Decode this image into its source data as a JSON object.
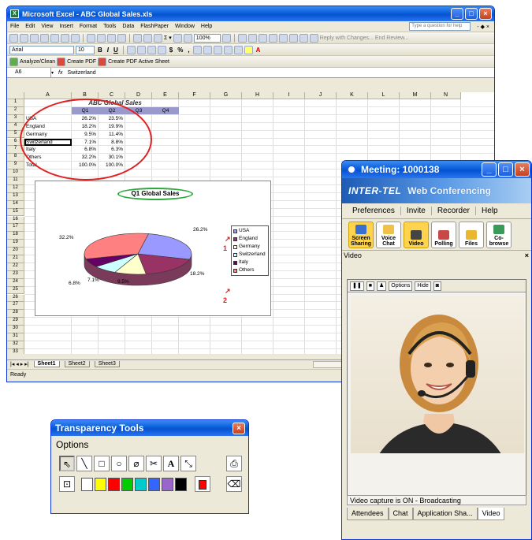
{
  "excel": {
    "title": "Microsoft Excel - ABC Global Sales.xls",
    "menu": [
      "File",
      "Edit",
      "View",
      "Insert",
      "Format",
      "Tools",
      "Data",
      "FlashPaper",
      "Window",
      "Help"
    ],
    "ask_placeholder": "Type a question for help",
    "mdi_controls": "- ◆ ×",
    "font_name": "Arial",
    "font_size": "10",
    "zoom": "100%",
    "toolbar3": [
      "Analyze/Clean",
      "Create PDF",
      "Create PDF Active Sheet"
    ],
    "reply_text": "Reply with Changes...",
    "end_review": "End Review...",
    "name_box": "A6",
    "formula_value": "Switzerland",
    "columns": [
      "A",
      "B",
      "C",
      "D",
      "E",
      "F",
      "G",
      "H",
      "I",
      "J",
      "K",
      "L",
      "M",
      "N"
    ],
    "rows": [
      "1",
      "2",
      "3",
      "4",
      "5",
      "6",
      "7",
      "8",
      "9",
      "10",
      "11",
      "12",
      "13",
      "14",
      "15",
      "16",
      "17",
      "18",
      "19",
      "20",
      "21",
      "22",
      "23",
      "24",
      "25",
      "26",
      "27",
      "28",
      "29",
      "30",
      "31",
      "32",
      "33"
    ],
    "sheet_title": "ABC Global Sales",
    "table": {
      "headers": [
        "Q1",
        "Q2",
        "Q3",
        "Q4"
      ],
      "rows": [
        {
          "country": "USA",
          "q1": "26.2%",
          "q2": "23.5%"
        },
        {
          "country": "England",
          "q1": "18.2%",
          "q2": "19.9%"
        },
        {
          "country": "Germany",
          "q1": "9.5%",
          "q2": "11.4%"
        },
        {
          "country": "Switzerland",
          "q1": "7.1%",
          "q2": "8.8%"
        },
        {
          "country": "Italy",
          "q1": "6.8%",
          "q2": "6.3%"
        },
        {
          "country": "Others",
          "q1": "32.2%",
          "q2": "30.1%"
        },
        {
          "country": "Total",
          "q1": "100.0%",
          "q2": "100.0%"
        }
      ]
    },
    "chart": {
      "title": "Q1 Global Sales",
      "labels": [
        "32.2%",
        "26.2%",
        "18.2%",
        "9.5%",
        "7.1%",
        "6.8%"
      ],
      "legend": [
        {
          "name": "USA",
          "color": "#9999ff"
        },
        {
          "name": "England",
          "color": "#993366"
        },
        {
          "name": "Germany",
          "color": "#ffffcc"
        },
        {
          "name": "Switzerland",
          "color": "#ccffff"
        },
        {
          "name": "Italy",
          "color": "#660066"
        },
        {
          "name": "Others",
          "color": "#ff8080"
        }
      ]
    },
    "annotations": [
      "1",
      "2"
    ],
    "sheet_tabs": [
      "Sheet1",
      "Sheet2",
      "Sheet3"
    ],
    "status": "Ready"
  },
  "meeting": {
    "title": "Meeting: 1000138",
    "brand": "INTER-TEL",
    "brand_sub": "Web Conferencing",
    "menu": [
      "Preferences",
      "Invite",
      "Recorder",
      "Help"
    ],
    "tools": [
      "Screen Sharing",
      "Voice Chat",
      "Video",
      "Polling",
      "Files",
      "Co-browse"
    ],
    "video_label": "Video",
    "video_close": "×",
    "video_buttons": [
      "Options",
      "Hide"
    ],
    "status": "Video capture is ON - Broadcasting",
    "tabs": [
      "Attendees",
      "Chat",
      "Application Sha...",
      "Video"
    ]
  },
  "transparency": {
    "title": "Transparency Tools",
    "options": "Options",
    "tool_glyphs": [
      "⇖",
      "╲",
      "□",
      "○",
      "⌀",
      "✂",
      "A",
      "⤡",
      "⎙"
    ],
    "palette": [
      "#ffffff",
      "#ffff00",
      "#ff0000",
      "#00cc00",
      "#00cccc",
      "#3366ff",
      "#9966cc",
      "#000000"
    ],
    "current_color": "#ff0000"
  }
}
